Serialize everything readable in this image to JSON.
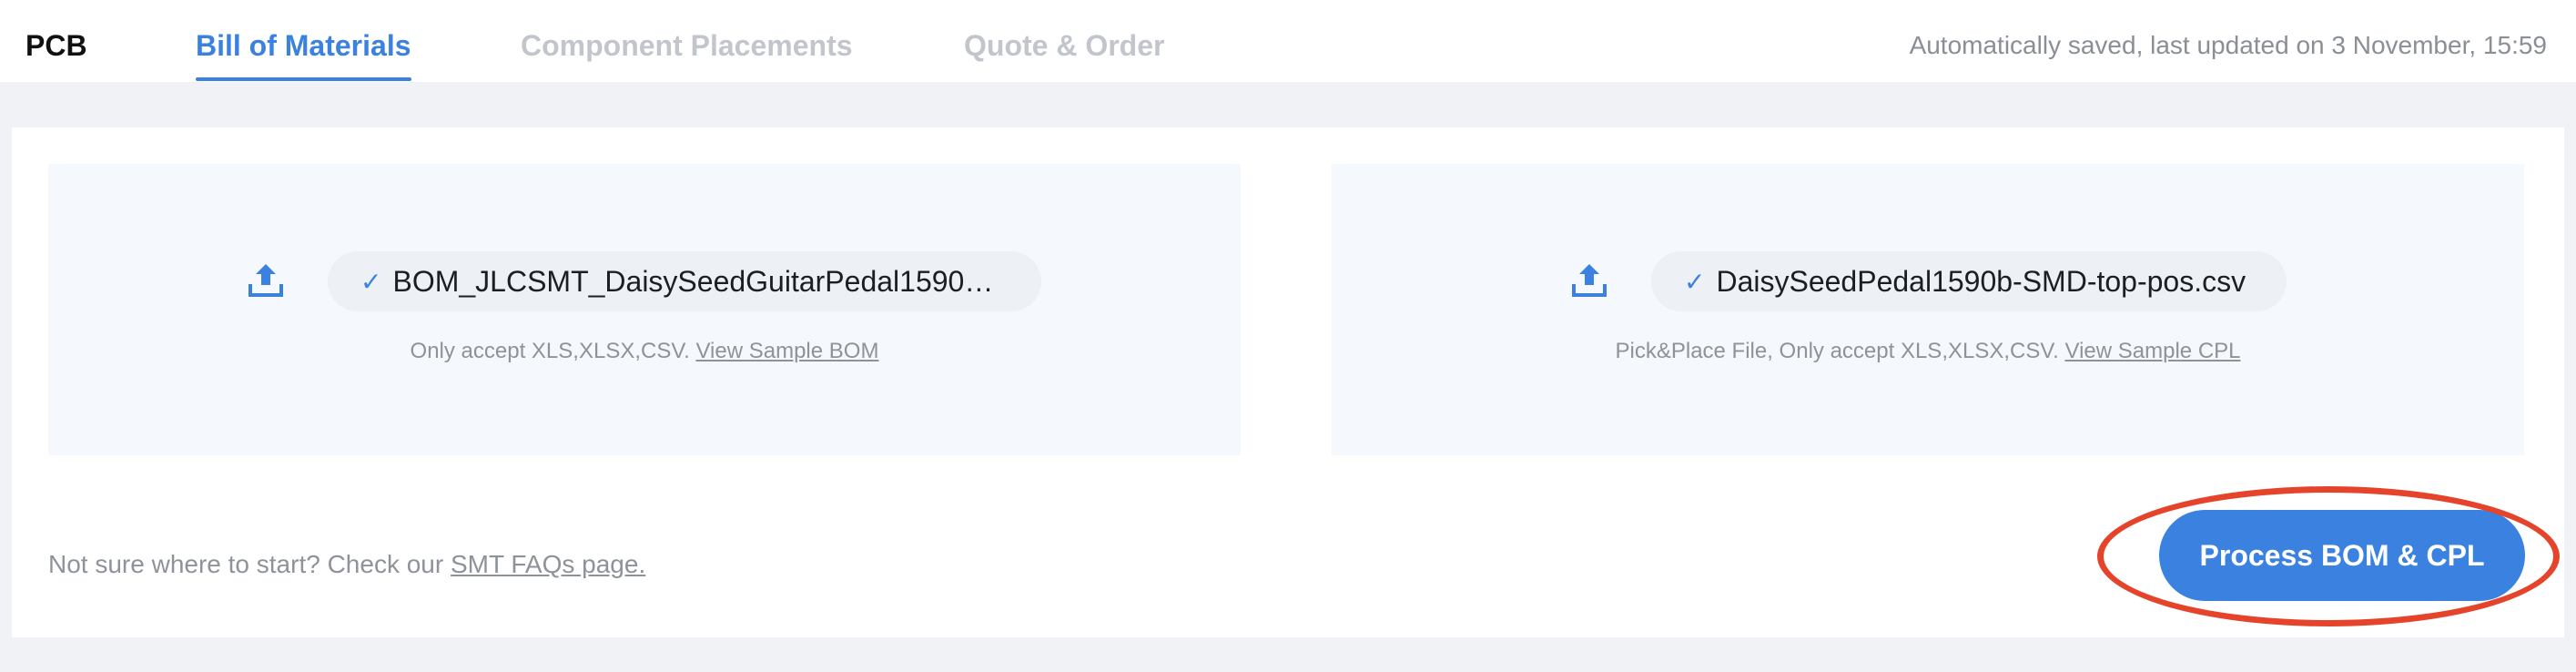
{
  "header": {
    "brand": "PCB",
    "tabs": [
      {
        "label": "Bill of Materials"
      },
      {
        "label": "Component Placements"
      },
      {
        "label": "Quote & Order"
      }
    ],
    "saved_status": "Automatically saved, last updated on 3 November, 15:59"
  },
  "bom_panel": {
    "file_name": "BOM_JLCSMT_DaisySeedGuitarPedal1590b…",
    "hint_text": "Only accept XLS,XLSX,CSV.",
    "hint_link": "View Sample BOM"
  },
  "cpl_panel": {
    "file_name": "DaisySeedPedal1590b-SMD-top-pos.csv",
    "hint_text": "Pick&Place File, Only accept XLS,XLSX,CSV.",
    "hint_link": "View Sample CPL"
  },
  "footer": {
    "faq_text": "Not sure where to start? Check our",
    "faq_link": "SMT FAQs page."
  },
  "actions": {
    "process_label": "Process BOM & CPL"
  },
  "icons": {
    "upload": "upload-icon",
    "check": "check-icon"
  },
  "colors": {
    "accent": "#3b82e0",
    "highlight": "#e5432a",
    "panel_bg": "#f5f8fc",
    "page_bg": "#f0f2f5"
  }
}
